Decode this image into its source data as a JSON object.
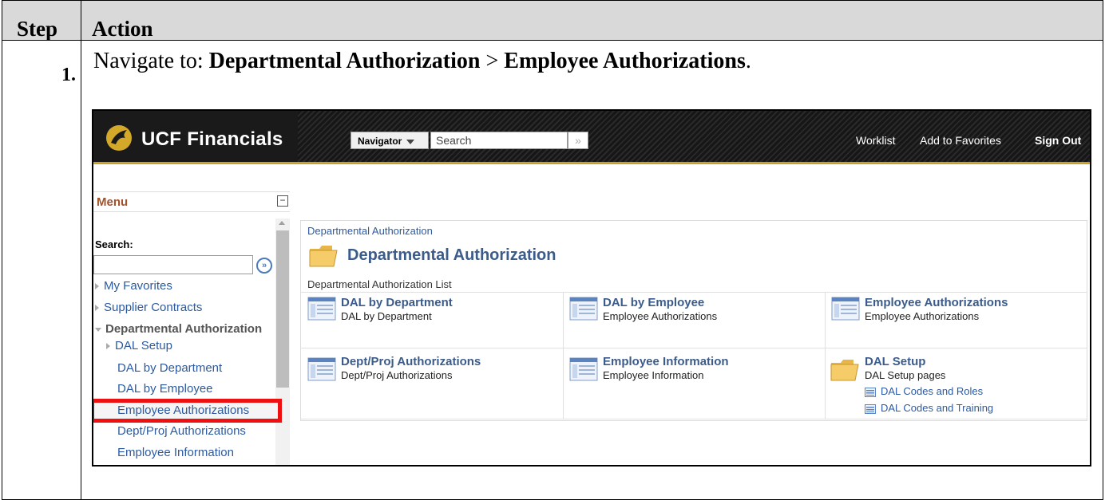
{
  "table": {
    "header_step": "Step",
    "header_action": "Action",
    "step_number": "1.",
    "instruction_prefix": "Navigate to: ",
    "instruction_bold1": "Departmental Authorization",
    "instruction_sep": " > ",
    "instruction_bold2": "Employee Authorizations",
    "instruction_suffix": "."
  },
  "banner": {
    "logo_text": "UCF Financials",
    "navigator_label": "Navigator",
    "search_placeholder": "Search",
    "go_glyph": "»",
    "links": [
      "Worklist",
      "Add to Favorites",
      "Sign Out"
    ]
  },
  "menu": {
    "title": "Menu",
    "collapse_glyph": "−",
    "search_label": "Search:",
    "go_glyph": "»",
    "items": [
      {
        "label": "My Favorites",
        "state": "collapsed"
      },
      {
        "label": "Supplier Contracts",
        "state": "collapsed"
      },
      {
        "label": "Departmental Authorization",
        "state": "expanded"
      },
      {
        "label": "DAL Setup",
        "state": "collapsed"
      },
      {
        "label": "DAL by Department",
        "state": "link"
      },
      {
        "label": "DAL by Employee",
        "state": "link"
      },
      {
        "label": "Employee Authorizations",
        "state": "highlighted"
      },
      {
        "label": "Dept/Proj Authorizations",
        "state": "link"
      },
      {
        "label": "Employee Information",
        "state": "link"
      }
    ]
  },
  "content": {
    "breadcrumb": "Departmental Authorization",
    "title": "Departmental Authorization",
    "list_label": "Departmental Authorization List",
    "tiles": [
      {
        "title": "DAL by Department",
        "subtitle": "DAL by Department",
        "icon": "page-icon"
      },
      {
        "title": "DAL by Employee",
        "subtitle": "Employee Authorizations",
        "icon": "page-icon"
      },
      {
        "title": "Employee Authorizations",
        "subtitle": "Employee Authorizations",
        "icon": "page-icon"
      },
      {
        "title": "Dept/Proj Authorizations",
        "subtitle": "Dept/Proj Authorizations",
        "icon": "page-icon"
      },
      {
        "title": "Employee Information",
        "subtitle": "Employee Information",
        "icon": "page-icon"
      },
      {
        "title": "DAL Setup",
        "subtitle": "DAL Setup pages",
        "icon": "folder-icon",
        "links": [
          "DAL Codes and Roles",
          "DAL Codes and Training"
        ]
      }
    ]
  },
  "colors": {
    "highlight": "#ee1111",
    "link": "#2c5aa0",
    "title": "#3b5b8a",
    "banner_gold": "#c9a227",
    "header_gray": "#d9d9d9"
  }
}
